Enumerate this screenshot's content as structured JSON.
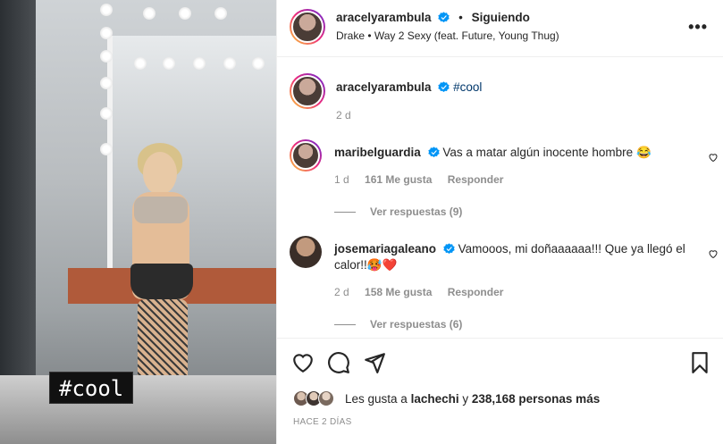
{
  "media": {
    "overlay_tag": "#cool"
  },
  "header": {
    "username": "aracelyarambula",
    "separator": "•",
    "follow_status": "Siguiendo",
    "music": "Drake • Way 2 Sexy (feat. Future, Young Thug)",
    "more_icon": "more-horizontal-icon",
    "more_glyph": "•••"
  },
  "caption": {
    "username": "aracelyarambula",
    "text": "#cool",
    "time": "2 d"
  },
  "comments": [
    {
      "username": "maribelguardia",
      "text": "Vas a matar algún inocente hombre 😂",
      "time": "1 d",
      "likes": "161 Me gusta",
      "reply": "Responder",
      "view_replies": "Ver respuestas (9)"
    },
    {
      "username": "josemariagaleano",
      "text": "Vamooos, mi doñaaaaaa!!! Que ya llegó el calor!!🥵❤️",
      "time": "2 d",
      "likes": "158 Me gusta",
      "reply": "Responder",
      "view_replies": "Ver respuestas (6)"
    }
  ],
  "likes_line": {
    "prefix": "Les gusta a ",
    "user": "lachechi",
    "middle": " y ",
    "count": "238,168 personas más"
  },
  "post_date": "HACE 2 DÍAS",
  "colors": {
    "accent_blue": "#0095f6",
    "link_blue": "#00376b",
    "muted": "#8e8e8e",
    "text": "#262626"
  }
}
